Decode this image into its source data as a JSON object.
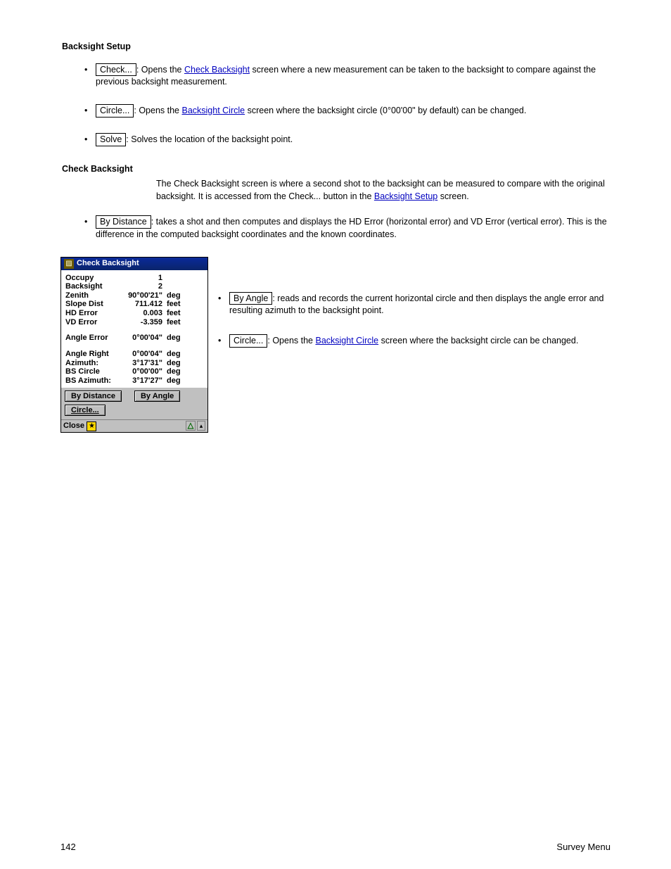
{
  "heading": "Backsight Setup",
  "bullets_top": [
    {
      "bullet": "•",
      "btn": "Check...",
      "pre": ": Opens the ",
      "link": "Check Backsight",
      "post": " screen where a new measurement can be taken to the backsight to compare against the previous backsight measurement."
    },
    {
      "bullet": "•",
      "btn": "Circle...",
      "pre": ": Opens the ",
      "link": "Backsight Circle",
      "post": " screen where the backsight circle (0°00'00\" by default) can be changed."
    },
    {
      "bullet": "•",
      "btn": "Solve",
      "pre": ": Solves the location of the backsight point.",
      "link": "",
      "post": ""
    }
  ],
  "check_para": {
    "head": "Check Backsight",
    "pre": "The Check Backsight screen is where a second shot to the backsight can be measured to compare with the original backsight. It is accessed from the Check... button in the ",
    "link": "Backsight Setup",
    "post": " screen."
  },
  "distance_bullet": {
    "bullet": "•",
    "btn": "By Distance",
    "text": ": takes a shot and then computes and displays the HD Error (horizontal error) and VD Error (vertical error). This is the difference in the computed backsight coordinates and the known coordinates."
  },
  "right_bullets": [
    {
      "bullet": "•",
      "btn": "By Angle",
      "text": ": reads and records the current horizontal circle and then displays the angle error and resulting azimuth to the backsight point."
    },
    {
      "bullet": "•",
      "btn": "Circle...",
      "pre": ": Opens the ",
      "link": "Backsight Circle",
      "post": " screen where the backsight circle can be changed."
    }
  ],
  "window": {
    "title": "Check Backsight",
    "rows": [
      {
        "lbl": "Occupy",
        "val": "1",
        "unit": ""
      },
      {
        "lbl": "Backsight",
        "val": "2",
        "unit": ""
      },
      {
        "lbl": "Zenith",
        "val": "90°00'21\"",
        "unit": "deg"
      },
      {
        "lbl": "Slope Dist",
        "val": "711.412",
        "unit": "feet"
      },
      {
        "lbl": "HD Error",
        "val": "0.003",
        "unit": "feet"
      },
      {
        "lbl": "VD Error",
        "val": "-3.359",
        "unit": "feet"
      },
      {
        "gap": true
      },
      {
        "lbl": "Angle Error",
        "val": "0°00'04\"",
        "unit": "deg"
      },
      {
        "gap": true
      },
      {
        "lbl": "Angle Right",
        "val": "0°00'04\"",
        "unit": "deg"
      },
      {
        "lbl": "Azimuth:",
        "val": "3°17'31\"",
        "unit": "deg"
      },
      {
        "lbl": "BS Circle",
        "val": "0°00'00\"",
        "unit": "deg"
      },
      {
        "lbl": "BS Azimuth:",
        "val": "3°17'27\"",
        "unit": "deg"
      }
    ],
    "btn_distance": "By Distance",
    "btn_angle": "By Angle",
    "btn_circle": "Circle...",
    "close": "Close"
  },
  "footer_left": "142",
  "footer_right": "Survey Menu"
}
